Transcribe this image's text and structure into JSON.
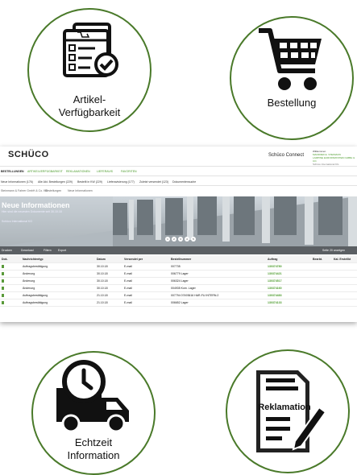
{
  "features": {
    "availability": "Artikel-\nVerfügbarkeit",
    "order": "Bestellung",
    "realtime": "Echtzeit\nInformation",
    "complaint_caption": "",
    "complaint_sign": "Reklamation"
  },
  "app": {
    "logo": "SCHÜCO",
    "title": "Schüco Connect",
    "user_lines": [
      "Willkommen",
      "MANFRED E. STEIMANN",
      "LAMPINE EUROPARKSTEIN GMBH & CO.",
      "Schüco International KG"
    ],
    "nav": [
      "BESTELLUNGEN",
      "ARTIKELVERFÜGBARKEIT",
      "REKLAMATIONEN",
      "LIEFERAVIS",
      "FAVORITEN"
    ],
    "tabs": [
      "Neue Informationen (176)",
      "Alle Akt. Bestellungen (229)",
      "Bestellt in KW (229)",
      "Lieferavisierung (177)",
      "Zuletzt versendet (123)",
      "Dokumentensuche"
    ],
    "breadcrumb": [
      "Steinmann & Fahrer GmbH & Co. KG",
      "Bestellungen",
      "Neue Informationen"
    ],
    "hero_title": "Neue Informationen",
    "hero_sub": "Hier sind die neuesten Dokumente seit 30.10.18",
    "hero_org": "Schüco International KG",
    "pages": [
      "1",
      "2",
      "3",
      "4",
      "5"
    ],
    "toolbar": [
      "Drucken",
      "Download",
      "Filtern",
      "Export",
      "Seite 20 anzeigen"
    ],
    "columns": [
      "Dok.",
      "Nachrichtentyp",
      "Datum",
      "Versendet per",
      "Bestellnummer",
      "Auftrag",
      "Bearbt.",
      "Kal. Erstellkt"
    ],
    "rows": [
      [
        "",
        "Auftragsbestätigung",
        "30.10.18",
        "E-mail",
        "007735",
        "130374780",
        "",
        ""
      ],
      [
        "",
        "Änderung",
        "30.10.18",
        "E-mail",
        "006779 Lager",
        "130374421",
        "",
        ""
      ],
      [
        "",
        "Änderung",
        "30.10.18",
        "E-mail",
        "006324 Lager",
        "130374517",
        "",
        ""
      ],
      [
        "",
        "Änderung",
        "30.10.18",
        "E-mail",
        "004935 Kom. Lager",
        "130374160",
        "",
        ""
      ],
      [
        "",
        "Auftragsbestätigung",
        "21.10.18",
        "E-mail",
        "007794 07493616 HAR-FU INTERN.2",
        "130374483",
        "",
        ""
      ],
      [
        "",
        "Auftragsbestätigung",
        "21.10.18",
        "E-mail",
        "006652 Lager",
        "130374133",
        "",
        ""
      ]
    ]
  },
  "colors": {
    "accent": "#4a9a2a",
    "circle_border": "#4a7a2a",
    "toolbar": "#5b5f63"
  }
}
